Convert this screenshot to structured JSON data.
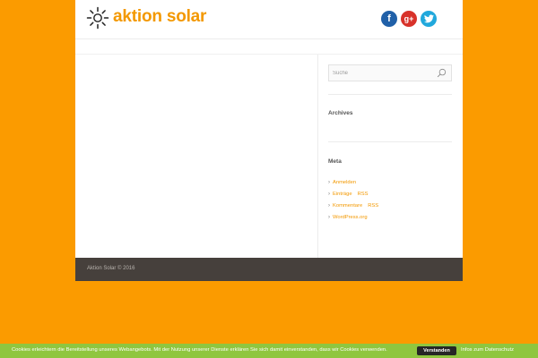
{
  "brand": {
    "name": "aktion solar",
    "color": "#f39800"
  },
  "social": [
    {
      "name": "facebook",
      "glyph": "f",
      "color": "#2060a8"
    },
    {
      "name": "google-plus",
      "glyph": "g+",
      "color": "#d8322a"
    },
    {
      "name": "twitter",
      "glyph": "twitter-bird",
      "color": "#21a8dc"
    }
  ],
  "sidebar": {
    "search": {
      "placeholder": "Suche",
      "icon": "search-icon"
    },
    "archives_title": "Archives",
    "meta_title": "Meta",
    "meta_items": [
      {
        "label": "Anmelden"
      },
      {
        "label": "Einträge",
        "suffix": "RSS"
      },
      {
        "label": "Kommentare",
        "suffix": "RSS"
      },
      {
        "label": "WordPress.org"
      }
    ]
  },
  "footer": {
    "copyright": "Aktion Solar © 2016"
  },
  "cookie_bar": {
    "message": "Cookies erleichtern die Bereitstellung unseres Webangebots. Mit der Nutzung unserer Dienste erklären Sie sich damit einverstanden, dass wir Cookies verwenden.",
    "accept_label": "Verstanden",
    "info_label": "Infos zum Datenschutz"
  },
  "colors": {
    "background": "#fb9b00",
    "footer": "#46403c",
    "cookie_bar": "#8fc63f"
  }
}
